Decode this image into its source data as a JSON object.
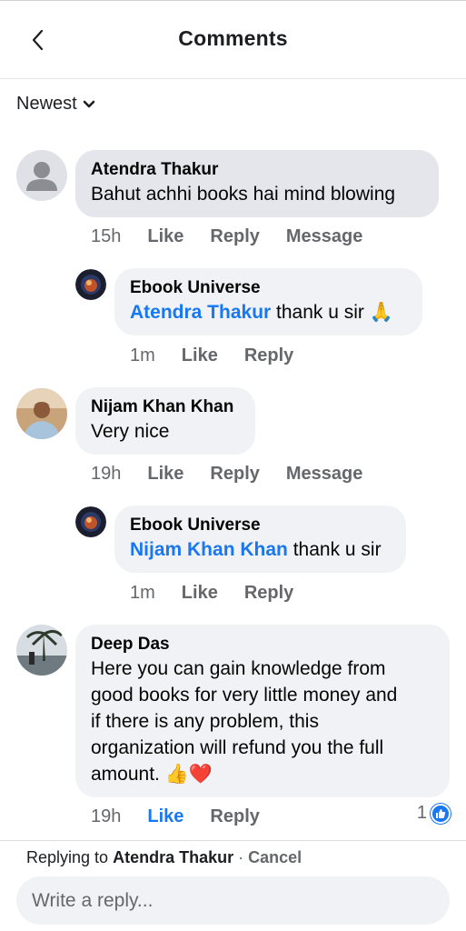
{
  "header": {
    "title": "Comments"
  },
  "sort": {
    "label": "Newest"
  },
  "comments": [
    {
      "author": "Atendra Thakur",
      "text": "Bahut achhi books hai mind blowing",
      "time": "15h",
      "like": "Like",
      "reply": "Reply",
      "message": "Message"
    },
    {
      "author": "Ebook Universe",
      "mention": "Atendra Thakur",
      "text": " thank u sir 🙏",
      "time": "1m",
      "like": "Like",
      "reply": "Reply"
    },
    {
      "author": "Nijam Khan Khan",
      "text": "Very nice",
      "time": "19h",
      "like": "Like",
      "reply": "Reply",
      "message": "Message"
    },
    {
      "author": "Ebook Universe",
      "mention": "Nijam Khan Khan",
      "text": " thank u sir",
      "time": "1m",
      "like": "Like",
      "reply": "Reply"
    },
    {
      "author": "Deep Das",
      "text_lines": [
        "Here you can gain knowledge from",
        "good books for very little money and",
        "if there is any problem, this",
        "organization will refund you the full",
        "amount. 👍❤️"
      ],
      "time": "19h",
      "like": "Like",
      "reply": "Reply",
      "reaction_count": "1"
    }
  ],
  "reply_bar": {
    "replying_prefix": "Replying to",
    "replying_to": "Atendra Thakur",
    "separator": " · ",
    "cancel": "Cancel",
    "placeholder": "Write a reply..."
  },
  "colors": {
    "accent": "#1877f2",
    "bubble": "#f0f2f5",
    "bubble_highlight": "#e4e6eb",
    "meta": "#65676b"
  }
}
